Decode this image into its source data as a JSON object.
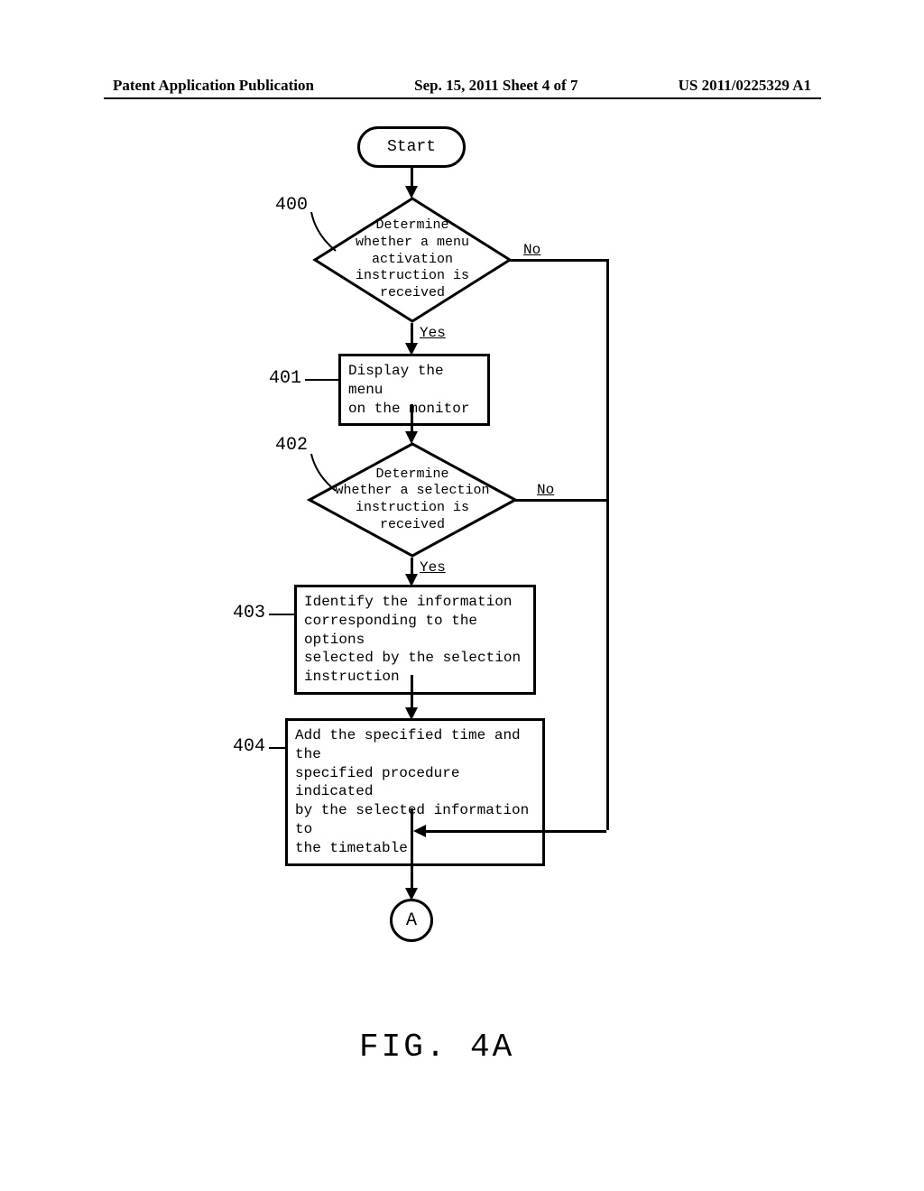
{
  "header": {
    "left": "Patent Application Publication",
    "center": "Sep. 15, 2011  Sheet 4 of 7",
    "right": "US 2011/0225329 A1"
  },
  "chart_data": {
    "type": "flowchart",
    "title": "FIG. 4A",
    "nodes": [
      {
        "id": "start",
        "type": "terminal",
        "text": "Start"
      },
      {
        "id": "400",
        "type": "decision",
        "label": "400",
        "text": "Determine whether a menu activation instruction is received"
      },
      {
        "id": "401",
        "type": "process",
        "label": "401",
        "text": "Display the menu on the monitor"
      },
      {
        "id": "402",
        "type": "decision",
        "label": "402",
        "text": "Determine whether a selection instruction is received"
      },
      {
        "id": "403",
        "type": "process",
        "label": "403",
        "text": "Identify the information corresponding to the options selected by the selection instruction"
      },
      {
        "id": "404",
        "type": "process",
        "label": "404",
        "text": "Add the specified time and the specified procedure indicated by the selected information to the timetable"
      },
      {
        "id": "A",
        "type": "connector",
        "text": "A"
      }
    ],
    "edges": [
      {
        "from": "start",
        "to": "400"
      },
      {
        "from": "400",
        "to": "401",
        "label": "Yes"
      },
      {
        "from": "400",
        "to": "A",
        "label": "No"
      },
      {
        "from": "401",
        "to": "402"
      },
      {
        "from": "402",
        "to": "403",
        "label": "Yes"
      },
      {
        "from": "402",
        "to": "A",
        "label": "No"
      },
      {
        "from": "403",
        "to": "404"
      },
      {
        "from": "404",
        "to": "A"
      }
    ]
  },
  "nodes": {
    "start": "Start",
    "d400_l1": "Determine",
    "d400_l2": "whether a menu",
    "d400_l3": "activation",
    "d400_l4": "instruction is",
    "d400_l5": "received",
    "p401_l1": "Display the menu",
    "p401_l2": "on the monitor",
    "d402_l1": "Determine",
    "d402_l2": "whether a selection",
    "d402_l3": "instruction is",
    "d402_l4": "received",
    "p403_l1": "Identify the information",
    "p403_l2": "corresponding to the options",
    "p403_l3": "selected by the selection",
    "p403_l4": "instruction",
    "p404_l1": "Add the specified time and the",
    "p404_l2": "specified procedure indicated",
    "p404_l3": "by the selected information to",
    "p404_l4": "the timetable",
    "conn_a": "A"
  },
  "labels": {
    "s400": "400",
    "s401": "401",
    "s402": "402",
    "s403": "403",
    "s404": "404",
    "yes": "Yes",
    "no": "No"
  },
  "figure": "FIG. 4A"
}
